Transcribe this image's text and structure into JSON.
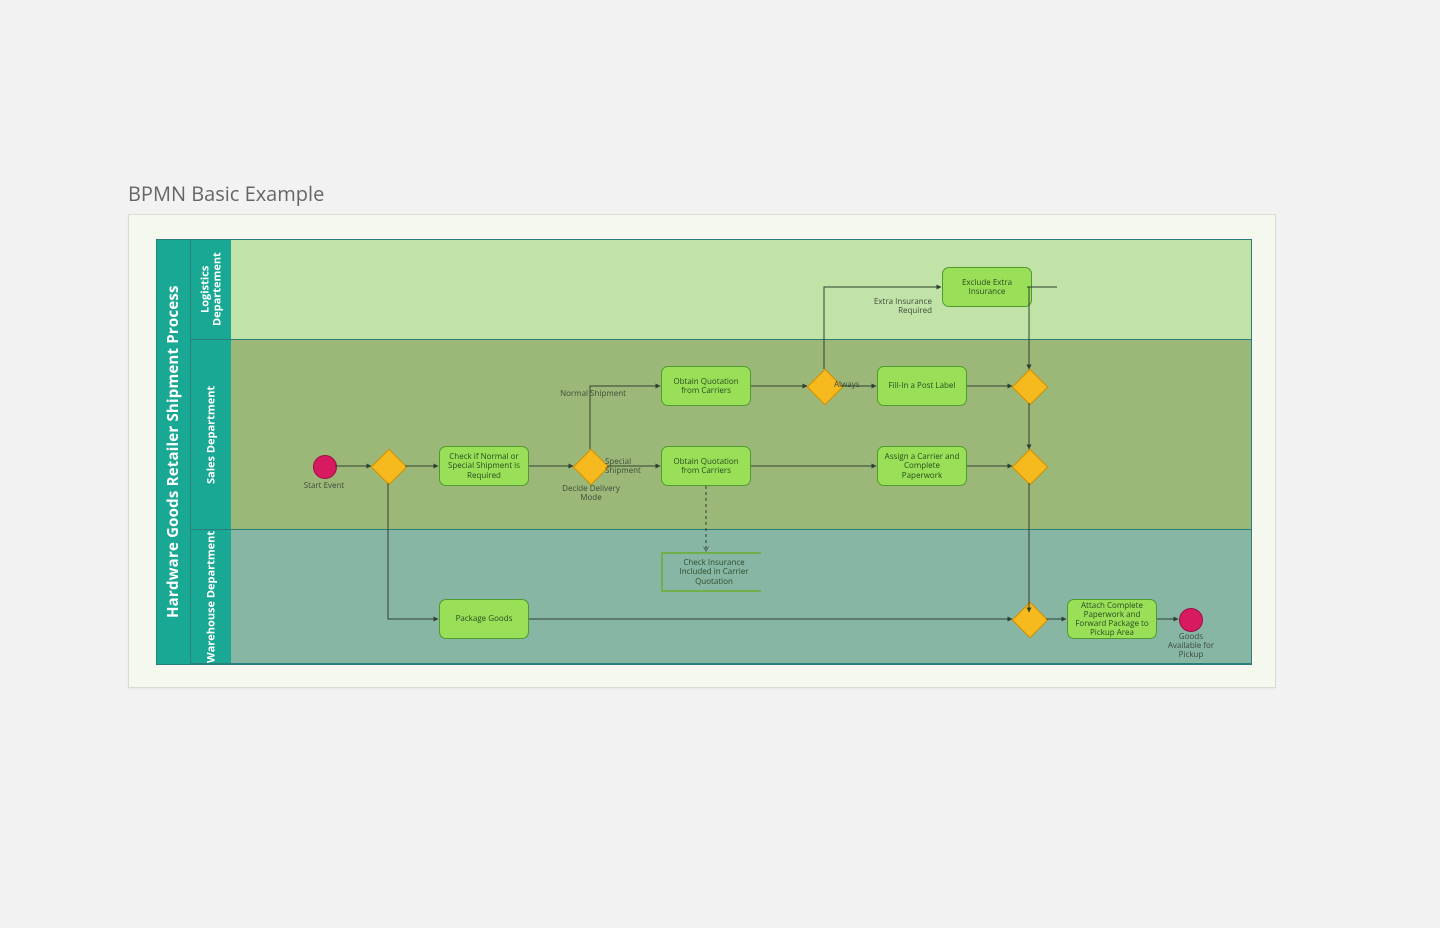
{
  "title": "BPMN Basic Example",
  "pool": {
    "name": "Hardware Goods Retailer Shipment Process",
    "lanes": {
      "logistics": "Logistics Departement",
      "sales": "Sales Department",
      "warehouse": "Warehouse Department"
    }
  },
  "events": {
    "start": "Start Event",
    "end": "Goods Available for Pickup"
  },
  "tasks": {
    "check_shipment": "Check if Normal or Special Shipment is Required",
    "obtain_q_top": "Obtain Quotation from Carriers",
    "obtain_q_mid": "Obtain Quotation from Carriers",
    "exclude_insurance": "Exclude Extra Insurance",
    "fill_post_label": "Fill-In a Post Label",
    "assign_carrier": "Assign a Carrier and Complete Paperwork",
    "package_goods": "Package Goods",
    "attach_paperwork": "Attach Complete Paperwork and Forward Package to Pickup Area"
  },
  "gateways": {
    "g1": "",
    "decide_mode": "Decide Delivery Mode",
    "g_insurance": "",
    "g_merge_top": "",
    "g_merge_mid": "",
    "g_merge_bottom": ""
  },
  "labels": {
    "normal_shipment": "Normal Shipment",
    "special_shipment": "Special Shipment",
    "extra_insurance_required": "Extra Insurance Required",
    "always": "Always"
  },
  "annotation": {
    "insurance_note": "Check Insurance Included in Carrier Quotation"
  },
  "chart_data": {
    "type": "bpmn",
    "pool": "Hardware Goods Retailer Shipment Process",
    "lanes": [
      "Logistics Departement",
      "Sales Department",
      "Warehouse Department"
    ],
    "nodes": [
      {
        "id": "start",
        "type": "startEvent",
        "lane": "Sales Department",
        "label": "Start Event"
      },
      {
        "id": "g1",
        "type": "parallelGateway",
        "lane": "Sales Department"
      },
      {
        "id": "t_check",
        "type": "task",
        "lane": "Sales Department",
        "label": "Check if Normal or Special Shipment is Required"
      },
      {
        "id": "g_decide",
        "type": "exclusiveGateway",
        "lane": "Sales Department",
        "label": "Decide Delivery Mode"
      },
      {
        "id": "t_q_normal",
        "type": "task",
        "lane": "Sales Department",
        "label": "Obtain Quotation from Carriers"
      },
      {
        "id": "t_q_special",
        "type": "task",
        "lane": "Sales Department",
        "label": "Obtain Quotation from Carriers"
      },
      {
        "id": "g_ins",
        "type": "inclusiveGateway",
        "lane": "Sales Department"
      },
      {
        "id": "t_exclude",
        "type": "task",
        "lane": "Logistics Departement",
        "label": "Exclude Extra Insurance"
      },
      {
        "id": "t_fill",
        "type": "task",
        "lane": "Sales Department",
        "label": "Fill-In a Post Label"
      },
      {
        "id": "g_merge_top",
        "type": "inclusiveGateway",
        "lane": "Sales Department"
      },
      {
        "id": "t_assign",
        "type": "task",
        "lane": "Sales Department",
        "label": "Assign a Carrier and Complete Paperwork"
      },
      {
        "id": "g_merge_mid",
        "type": "exclusiveGateway",
        "lane": "Sales Department"
      },
      {
        "id": "t_pack",
        "type": "task",
        "lane": "Warehouse Department",
        "label": "Package Goods"
      },
      {
        "id": "g_merge_bot",
        "type": "parallelGateway",
        "lane": "Warehouse Department"
      },
      {
        "id": "t_attach",
        "type": "task",
        "lane": "Warehouse Department",
        "label": "Attach Complete Paperwork and Forward Package to Pickup Area"
      },
      {
        "id": "end",
        "type": "endEvent",
        "lane": "Warehouse Department",
        "label": "Goods Available for Pickup"
      },
      {
        "id": "note",
        "type": "textAnnotation",
        "lane": "Warehouse Department",
        "label": "Check Insurance Included in Carrier Quotation"
      }
    ],
    "flows": [
      {
        "from": "start",
        "to": "g1"
      },
      {
        "from": "g1",
        "to": "t_check"
      },
      {
        "from": "g1",
        "to": "t_pack"
      },
      {
        "from": "t_check",
        "to": "g_decide"
      },
      {
        "from": "g_decide",
        "to": "t_q_normal",
        "label": "Normal Shipment"
      },
      {
        "from": "g_decide",
        "to": "t_q_special",
        "label": "Special Shipment"
      },
      {
        "from": "t_q_normal",
        "to": "g_ins"
      },
      {
        "from": "g_ins",
        "to": "t_exclude",
        "label": "Extra Insurance Required"
      },
      {
        "from": "g_ins",
        "to": "t_fill",
        "label": "Always"
      },
      {
        "from": "t_exclude",
        "to": "g_merge_top"
      },
      {
        "from": "t_fill",
        "to": "g_merge_top"
      },
      {
        "from": "t_q_special",
        "to": "t_assign"
      },
      {
        "from": "t_assign",
        "to": "g_merge_mid"
      },
      {
        "from": "g_merge_top",
        "to": "g_merge_mid"
      },
      {
        "from": "g_merge_mid",
        "to": "g_merge_bot"
      },
      {
        "from": "t_pack",
        "to": "g_merge_bot"
      },
      {
        "from": "g_merge_bot",
        "to": "t_attach"
      },
      {
        "from": "t_attach",
        "to": "end"
      },
      {
        "from": "t_q_special",
        "to": "note",
        "type": "association"
      }
    ]
  }
}
